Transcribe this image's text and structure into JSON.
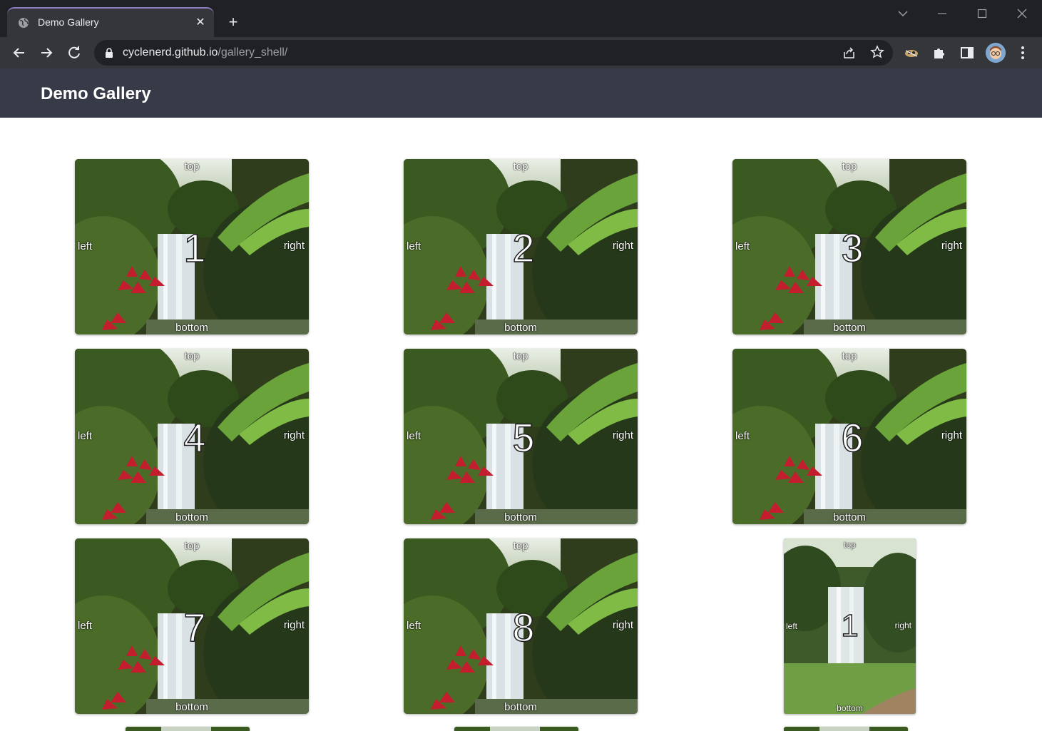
{
  "browser": {
    "tab": {
      "title": "Demo Gallery",
      "favicon": "globe-icon",
      "close_glyph": "✕"
    },
    "new_tab_glyph": "+",
    "address": {
      "host": "cyclenerd.github.io",
      "path": "/gallery_shell/"
    },
    "window_controls": [
      "tab-search-icon",
      "minimize-icon",
      "maximize-icon",
      "close-window-icon"
    ],
    "toolbar_icons": [
      "back-icon",
      "forward-icon",
      "reload-icon",
      "share-icon",
      "star-icon",
      "extension-icon",
      "puzzle-icon",
      "side-panel-icon",
      "avatar",
      "menu-icon"
    ]
  },
  "page": {
    "title": "Demo Gallery",
    "header_color": "#363b47"
  },
  "gallery": {
    "items": [
      {
        "number": "1",
        "top": "top",
        "bottom": "bottom",
        "left": "left",
        "right": "right",
        "orientation": "landscape"
      },
      {
        "number": "2",
        "top": "top",
        "bottom": "bottom",
        "left": "left",
        "right": "right",
        "orientation": "landscape"
      },
      {
        "number": "3",
        "top": "top",
        "bottom": "bottom",
        "left": "left",
        "right": "right",
        "orientation": "landscape"
      },
      {
        "number": "4",
        "top": "top",
        "bottom": "bottom",
        "left": "left",
        "right": "right",
        "orientation": "landscape"
      },
      {
        "number": "5",
        "top": "top",
        "bottom": "bottom",
        "left": "left",
        "right": "right",
        "orientation": "landscape"
      },
      {
        "number": "6",
        "top": "top",
        "bottom": "bottom",
        "left": "left",
        "right": "right",
        "orientation": "landscape"
      },
      {
        "number": "7",
        "top": "top",
        "bottom": "bottom",
        "left": "left",
        "right": "right",
        "orientation": "landscape"
      },
      {
        "number": "8",
        "top": "top",
        "bottom": "bottom",
        "left": "left",
        "right": "right",
        "orientation": "landscape"
      },
      {
        "number": "1",
        "top": "top",
        "bottom": "bottom",
        "left": "left",
        "right": "right",
        "orientation": "portrait"
      }
    ]
  }
}
